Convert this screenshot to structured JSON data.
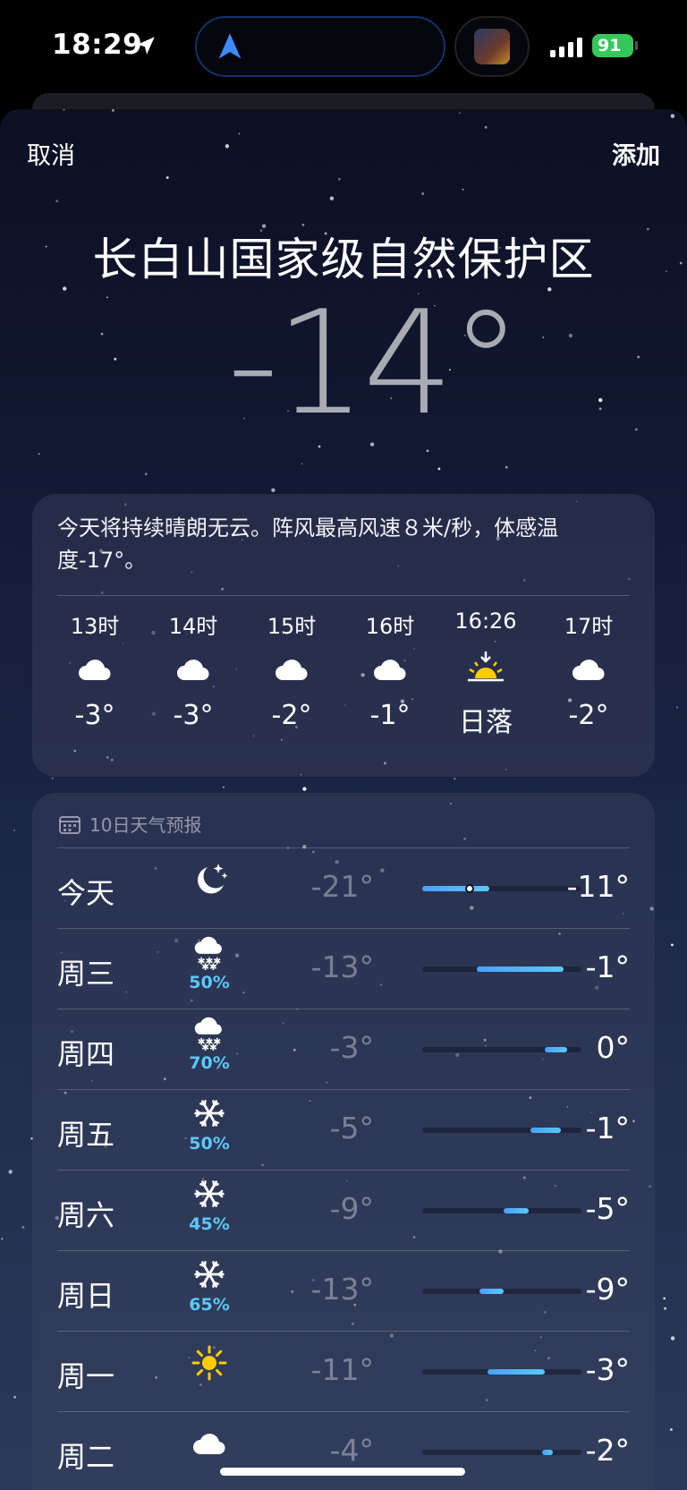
{
  "status_bar": {
    "time": "18:29",
    "battery": "91"
  },
  "sheet": {
    "cancel_label": "取消",
    "add_label": "添加",
    "location": "长白山国家级自然保护区",
    "current_temp": "-14°"
  },
  "hourly": {
    "summary": "今天将持续晴朗无云。阵风最高风速８米/秒，体感温度-17°。",
    "items": [
      {
        "label": "13时",
        "icon": "cloud-icon",
        "temp": "-3°"
      },
      {
        "label": "14时",
        "icon": "cloud-icon",
        "temp": "-3°"
      },
      {
        "label": "15时",
        "icon": "cloud-icon",
        "temp": "-2°"
      },
      {
        "label": "16时",
        "icon": "cloud-icon",
        "temp": "-1°"
      },
      {
        "label": "16:26",
        "icon": "sunset-icon",
        "temp": "日落"
      },
      {
        "label": "17时",
        "icon": "cloud-icon",
        "temp": "-2°"
      }
    ]
  },
  "forecast": {
    "header": "10日天气预报",
    "days": [
      {
        "day": "今天",
        "icon": "moon-stars-icon",
        "prob": "",
        "low": "-21°",
        "high": "-11°",
        "bar_start": 0.0,
        "bar_end": 0.42,
        "current": 0.3
      },
      {
        "day": "周三",
        "icon": "snow-cloud-icon",
        "prob": "50%",
        "low": "-13°",
        "high": "-1°",
        "bar_start": 0.34,
        "bar_end": 0.89
      },
      {
        "day": "周四",
        "icon": "snow-cloud-icon",
        "prob": "70%",
        "low": "-3°",
        "high": "0°",
        "bar_start": 0.77,
        "bar_end": 0.91
      },
      {
        "day": "周五",
        "icon": "snowflake-icon",
        "prob": "50%",
        "low": "-5°",
        "high": "-1°",
        "bar_start": 0.68,
        "bar_end": 0.87
      },
      {
        "day": "周六",
        "icon": "snowflake-icon",
        "prob": "45%",
        "low": "-9°",
        "high": "-5°",
        "bar_start": 0.51,
        "bar_end": 0.67
      },
      {
        "day": "周日",
        "icon": "snowflake-icon",
        "prob": "65%",
        "low": "-13°",
        "high": "-9°",
        "bar_start": 0.36,
        "bar_end": 0.51
      },
      {
        "day": "周一",
        "icon": "sun-icon",
        "prob": "",
        "low": "-11°",
        "high": "-3°",
        "bar_start": 0.41,
        "bar_end": 0.77
      },
      {
        "day": "周二",
        "icon": "cloud-icon",
        "prob": "",
        "low": "-4°",
        "high": "-2°",
        "bar_start": 0.75,
        "bar_end": 0.82
      }
    ]
  },
  "colors": {
    "accent": "#5ac8fa",
    "battery": "#35c759",
    "sun": "#ffcc00"
  }
}
